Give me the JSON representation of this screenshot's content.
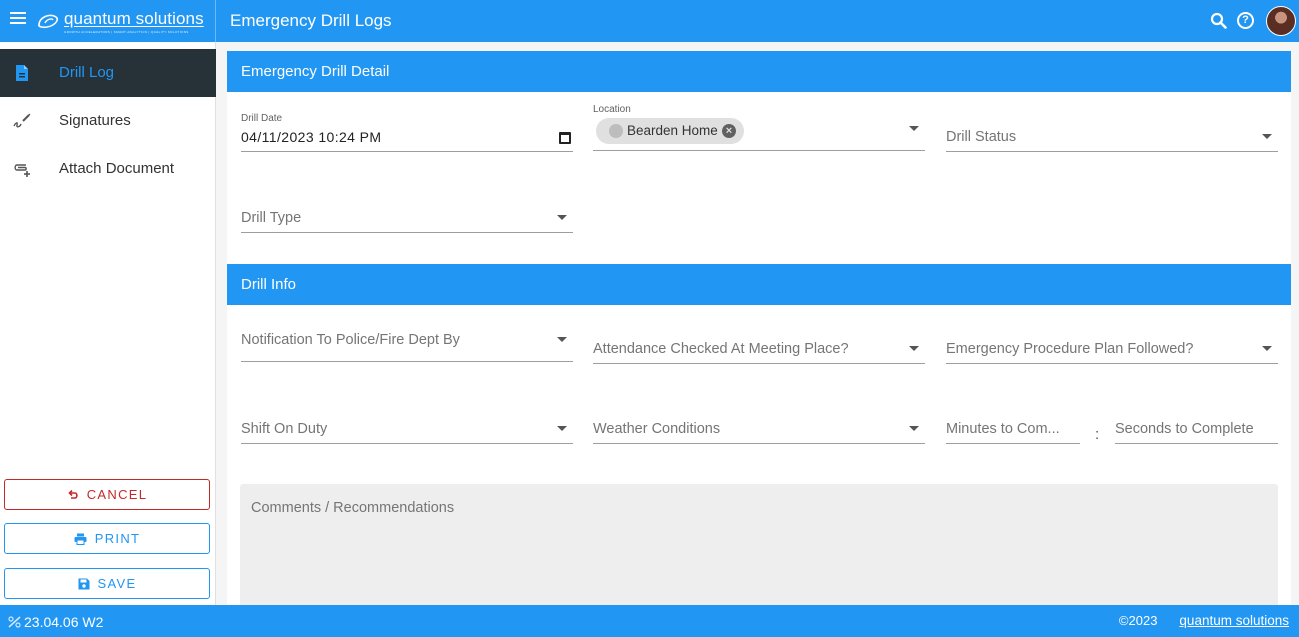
{
  "topbar": {
    "brand_name": "quantum solutions",
    "brand_tagline": "GROWTH ACCELERATORS | SMART ANALYTICS | QUALITY SOLUTIONS",
    "page_title": "Emergency Drill Logs",
    "help_glyph": "?"
  },
  "sidebar": {
    "items": [
      {
        "label": "Drill Log",
        "icon": "document-icon",
        "active": true
      },
      {
        "label": "Signatures",
        "icon": "signature-icon",
        "active": false
      },
      {
        "label": "Attach Document",
        "icon": "attach-document-icon",
        "active": false
      }
    ],
    "buttons": {
      "cancel": "CANCEL",
      "print": "PRINT",
      "save": "SAVE"
    }
  },
  "detail": {
    "header": "Emergency Drill Detail",
    "drill_date_label": "Drill Date",
    "drill_date_value": "04/11/2023 10:24 PM",
    "location_label": "Location",
    "location_chip": "Bearden Home",
    "chip_remove": "×",
    "drill_status_placeholder": "Drill Status",
    "drill_type_placeholder": "Drill Type"
  },
  "info": {
    "header": "Drill Info",
    "notification_placeholder": "Notification To Police/Fire Dept By",
    "attendance_placeholder": "Attendance Checked At Meeting Place?",
    "procedure_placeholder": "Emergency Procedure Plan Followed?",
    "shift_placeholder": "Shift On Duty",
    "weather_placeholder": "Weather Conditions",
    "minutes_placeholder": "Minutes to Com...",
    "time_separator": ":",
    "seconds_placeholder": "Seconds to Complete",
    "comments_placeholder": "Comments / Recommendations"
  },
  "footer": {
    "version": "23.04.06 W2",
    "copyright": "©2023",
    "brand": "quantum solutions"
  },
  "colors": {
    "primary": "#2196f3",
    "sidebar_active": "#263238",
    "cancel": "#c62828"
  }
}
